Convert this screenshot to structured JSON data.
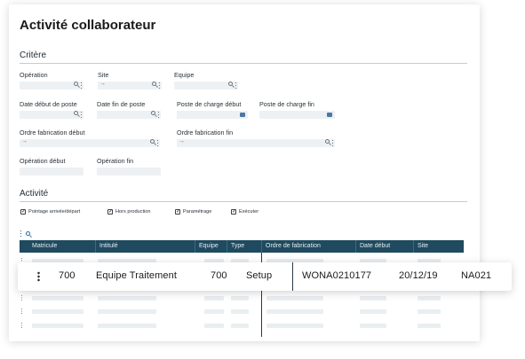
{
  "page_title": "Activité collaborateur",
  "criteria": {
    "title": "Critère",
    "fields": {
      "operation": {
        "label": "Opération",
        "value": ""
      },
      "site": {
        "label": "Site",
        "value": ""
      },
      "equipe": {
        "label": "Equipe",
        "value": ""
      },
      "date_debut_poste": {
        "label": "Date début de poste",
        "value": ""
      },
      "date_fin_poste": {
        "label": "Date fin de poste",
        "value": ""
      },
      "poste_charge_debut": {
        "label": "Poste de charge début",
        "value": ""
      },
      "poste_charge_fin": {
        "label": "Poste de charge fin",
        "value": ""
      },
      "of_debut": {
        "label": "Ordre fabrication début",
        "value": ""
      },
      "of_fin": {
        "label": "Ordre fabrication fin",
        "value": ""
      },
      "operation_debut": {
        "label": "Opération début",
        "value": ""
      },
      "operation_fin": {
        "label": "Opération fin",
        "value": ""
      }
    }
  },
  "activity": {
    "title": "Activité",
    "checkboxes": [
      {
        "label": "Pointage arrivée/départ",
        "checked": true
      },
      {
        "label": "Hors production",
        "checked": true
      },
      {
        "label": "Paramétrage",
        "checked": true
      },
      {
        "label": "Exécuter",
        "checked": true
      }
    ]
  },
  "table": {
    "columns": [
      "Matricule",
      "Intitulé",
      "Equipe",
      "Type",
      "Ordre de fabrication",
      "Date début",
      "Site"
    ],
    "highlighted_row": {
      "matricule": "700",
      "intitule": "Equipe Traitement",
      "equipe": "700",
      "type": "Setup",
      "ordre_fabrication": "WONA0210177",
      "date_debut": "20/12/19",
      "site": "NA021"
    }
  },
  "icons": {
    "lookup": "search-icon",
    "menu": "kebab-icon",
    "date": "calendar-icon",
    "check": "checkmark-icon"
  },
  "colors": {
    "table_header": "#1f4a5f",
    "accent": "#2e6c9c",
    "section_line": "#b8d0da"
  }
}
